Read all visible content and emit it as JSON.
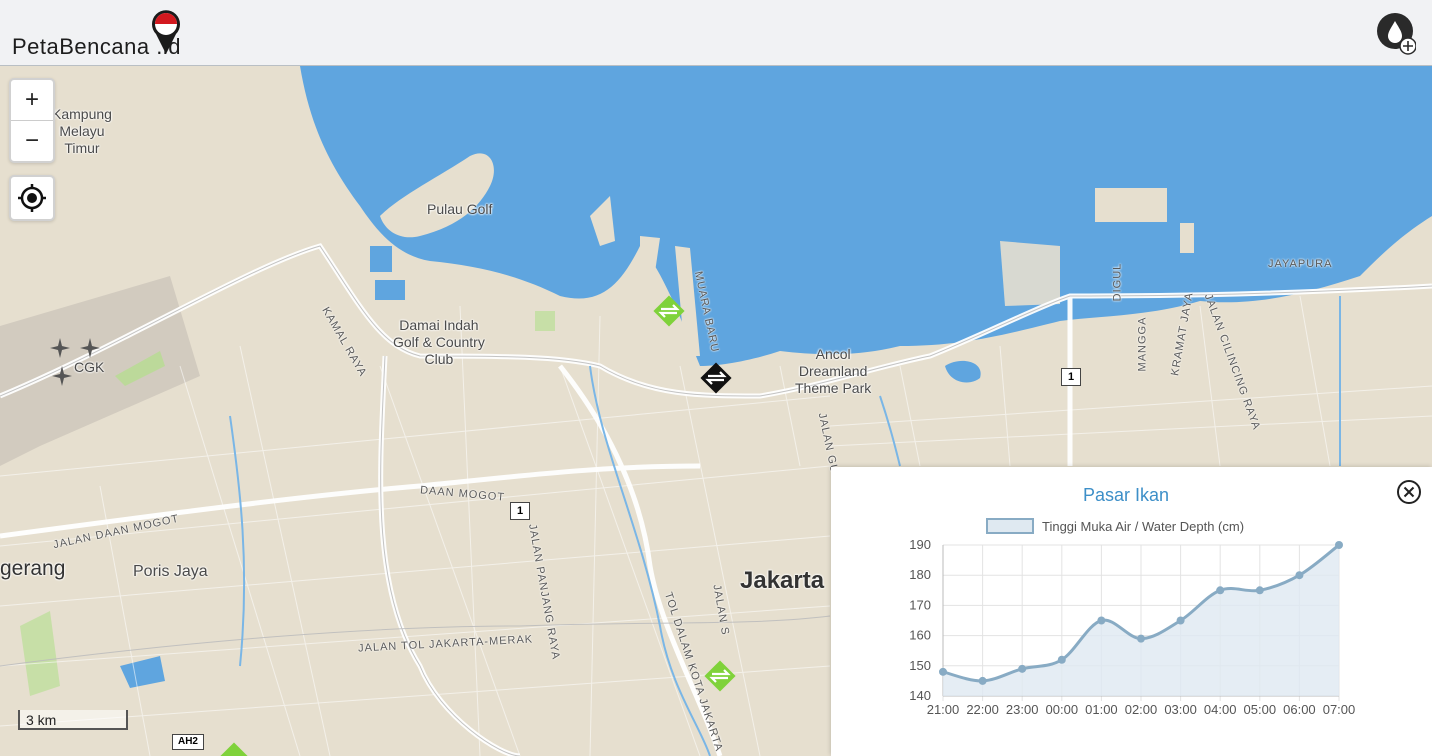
{
  "header": {
    "logo_text": "PetaBencana",
    "logo_suffix": "id",
    "report_button": "add-report"
  },
  "map": {
    "zoom_in": "+",
    "zoom_out": "−",
    "scale": "3 km",
    "labels": {
      "kampung": "Kampung\nMelayu\nTimur",
      "pulau_golf": "Pulau Golf",
      "damai_indah": "Damai Indah\nGolf & Country\nClub",
      "cgk": "CGK",
      "kamal_raya": "KAMAL RAYA",
      "muara_baru": "MUARA BARU",
      "ancol": "Ancol\nDreamland\nTheme Park",
      "mangga": "MANGGA",
      "kramat_jaya": "KRAMAT JAYA",
      "cilincing": "JALAN CILINCING RAYA",
      "jayapura": "JAYAPURA",
      "digul": "DIGUL",
      "daan_mogot": "DAAN MOGOT",
      "jalan_daan_mogot": "JALAN DAAN MOGOT",
      "tangerang": "gerang",
      "poris_jaya": "Poris Jaya",
      "jalan_panjang": "JALAN PANJANG RAYA",
      "tol_jakarta_merak": "JALAN TOL JAKARTA-MERAK",
      "tol_dalam_kota": "TOL DALAM KOTA JAKARTA",
      "jalan_s": "JALAN S",
      "jalan_gunung": "JALAN GUNU",
      "jakarta": "Jakarta",
      "route_1a": "1",
      "route_1b": "1",
      "ah2": "AH2"
    }
  },
  "popup": {
    "title": "Pasar Ikan",
    "close": "close",
    "legend": "Tinggi Muka Air / Water Depth (cm)"
  },
  "chart_data": {
    "type": "area",
    "title": "Pasar Ikan",
    "series": [
      {
        "name": "Tinggi Muka Air / Water Depth (cm)",
        "values": [
          148,
          145,
          149,
          152,
          165,
          159,
          165,
          175,
          175,
          180,
          190
        ]
      }
    ],
    "x": [
      "21:00",
      "22:00",
      "23:00",
      "00:00",
      "01:00",
      "02:00",
      "03:00",
      "04:00",
      "05:00",
      "06:00",
      "07:00"
    ],
    "ylim": [
      140,
      190
    ],
    "yticks": [
      190,
      180,
      170,
      160,
      150,
      140
    ],
    "grid": true,
    "legend_position": "top",
    "colors": {
      "line": "#88abc4",
      "fill": "#dfe9f1"
    }
  }
}
